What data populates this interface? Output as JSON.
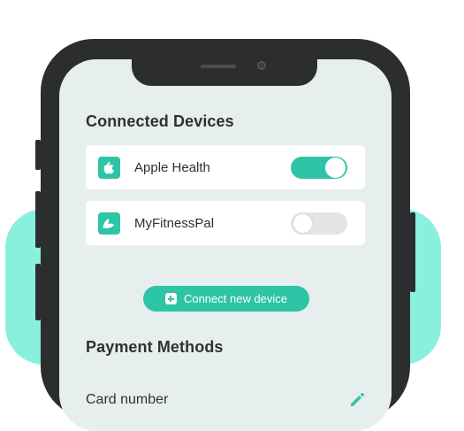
{
  "connected_devices": {
    "title": "Connected Devices",
    "devices": [
      {
        "label": "Apple Health",
        "icon": "apple-icon",
        "enabled": true
      },
      {
        "label": "MyFitnessPal",
        "icon": "myfitnesspal-icon",
        "enabled": false
      }
    ],
    "connect_button_label": "Connect new device"
  },
  "payment_methods": {
    "title": "Payment Methods",
    "card_number_label": "Card number",
    "edit_icon": "pencil-icon"
  },
  "colors": {
    "accent": "#2ec4a6",
    "background_blob": "#8af0de",
    "screen_bg": "#e7efee",
    "phone_frame": "#2b2d2f"
  }
}
